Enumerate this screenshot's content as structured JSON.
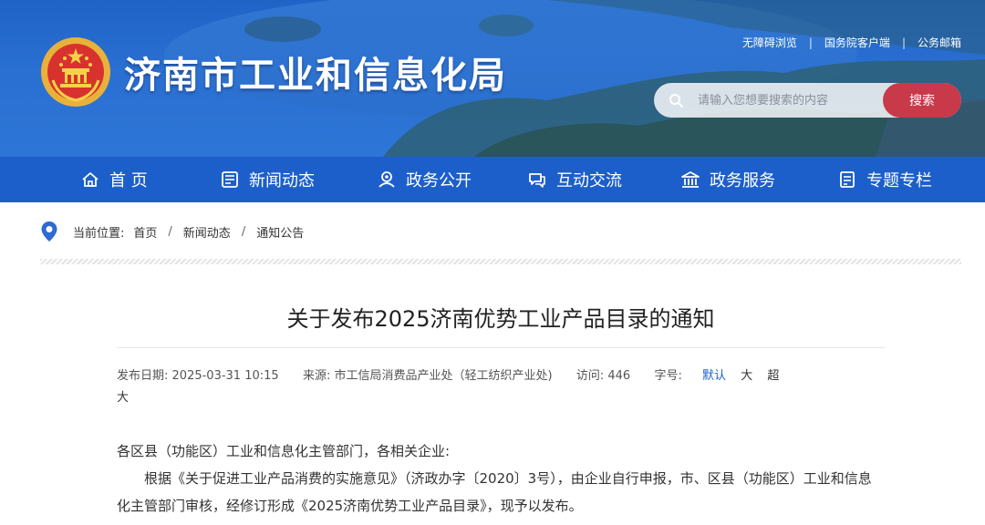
{
  "header": {
    "site_title": "济南市工业和信息化局",
    "top_links": [
      "无障碍浏览",
      "国务院客户端",
      "公务邮箱"
    ],
    "search": {
      "placeholder": "请输入您想要搜索的内容",
      "button_label": "搜索"
    }
  },
  "nav": {
    "items": [
      {
        "label": "首 页",
        "icon": "home-icon"
      },
      {
        "label": "新闻动态",
        "icon": "news-icon"
      },
      {
        "label": "政务公开",
        "icon": "gov-open-icon"
      },
      {
        "label": "互动交流",
        "icon": "chat-icon"
      },
      {
        "label": "政务服务",
        "icon": "service-building-icon"
      },
      {
        "label": "专题专栏",
        "icon": "topic-list-icon"
      }
    ]
  },
  "breadcrumb": {
    "prefix": "当前位置:",
    "items": [
      "首页",
      "新闻动态",
      "通知公告"
    ],
    "separator": "/"
  },
  "article": {
    "title": "关于发布2025济南优势工业产品目录的通知",
    "meta": {
      "date_label": "发布日期:",
      "date": "2025-03-31 10:15",
      "source_label": "来源:",
      "source": "市工信局消费品产业处（轻工纺织产业处)",
      "visits_label": "访问:",
      "visits": "446",
      "font_label": "字号:",
      "font_sizes": [
        "默认",
        "大",
        "超大"
      ]
    },
    "paragraphs": [
      "各区县（功能区）工业和信息化主管部门，各相关企业:",
      "根据《关于促进工业产品消费的实施意见》（济政办字〔2020〕3号），由企业自行申报，市、区县（功能区）工业和信息化主管部门审核，经修订形成《2025济南优势工业产品目录》，现予以发布。"
    ]
  },
  "colors": {
    "header_blue": "#2a6fd2",
    "nav_blue": "#1c5fcb",
    "search_button": "#c8394a",
    "active_font_size": "#1c5fcb"
  }
}
